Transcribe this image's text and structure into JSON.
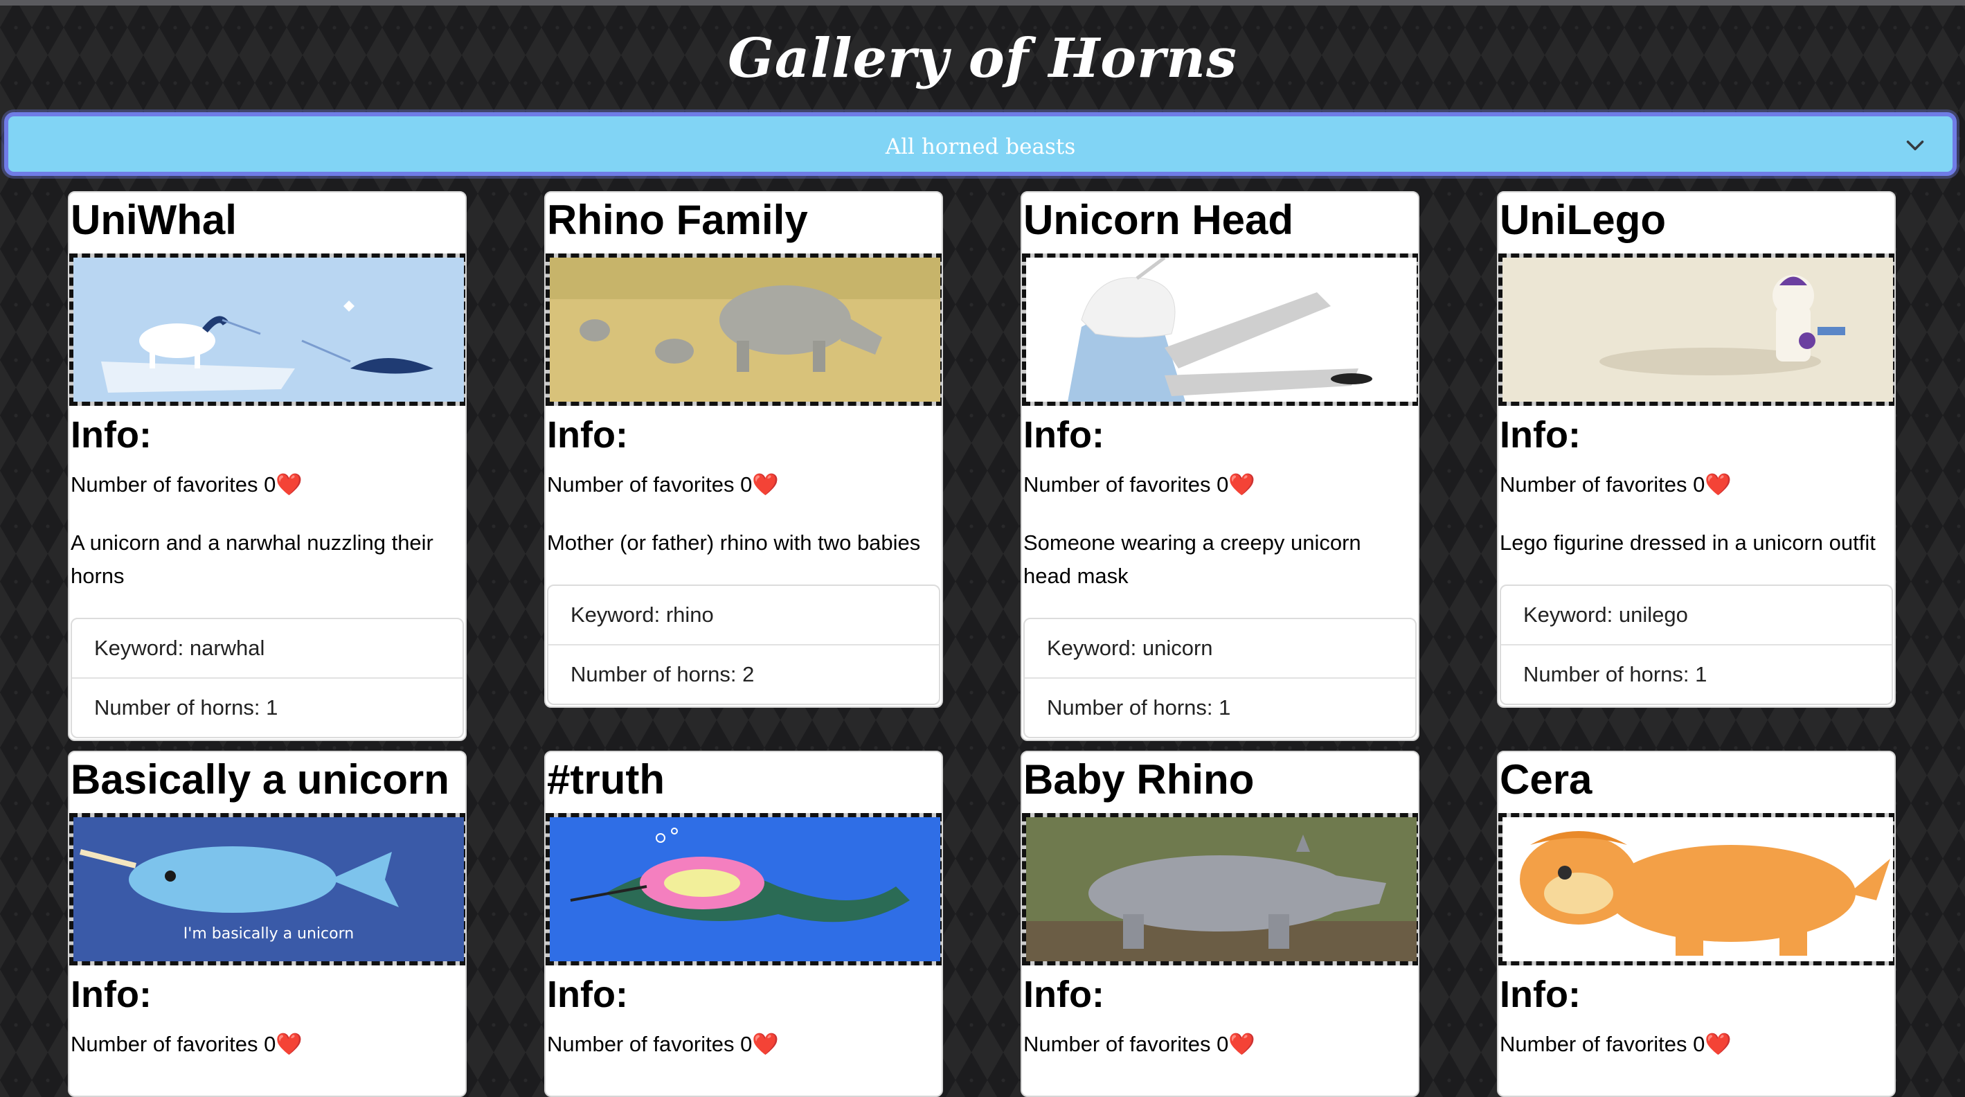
{
  "page": {
    "title": "Gallery of Horns"
  },
  "filter": {
    "selected": "All horned beasts"
  },
  "labels": {
    "info": "Info:",
    "favorites_prefix": "Number of favorites ",
    "heart": "❤️",
    "keyword_prefix": "Keyword: ",
    "horns_prefix": "Number of horns: "
  },
  "beasts": [
    {
      "title": "UniWhal",
      "favorites": "0",
      "description": "A unicorn and a narwhal nuzzling their horns",
      "keyword": "narwhal",
      "horns": "1"
    },
    {
      "title": "Rhino Family",
      "favorites": "0",
      "description": "Mother (or father) rhino with two babies",
      "keyword": "rhino",
      "horns": "2"
    },
    {
      "title": "Unicorn Head",
      "favorites": "0",
      "description": "Someone wearing a creepy unicorn head mask",
      "keyword": "unicorn",
      "horns": "1"
    },
    {
      "title": "UniLego",
      "favorites": "0",
      "description": "Lego figurine dressed in a unicorn outfit",
      "keyword": "unilego",
      "horns": "1"
    },
    {
      "title": "Basically a unicorn",
      "favorites": "0",
      "image_caption": "I'm basically a unicorn"
    },
    {
      "title": "#truth",
      "favorites": "0"
    },
    {
      "title": "Baby Rhino",
      "favorites": "0"
    },
    {
      "title": "Cera",
      "favorites": "0"
    }
  ]
}
